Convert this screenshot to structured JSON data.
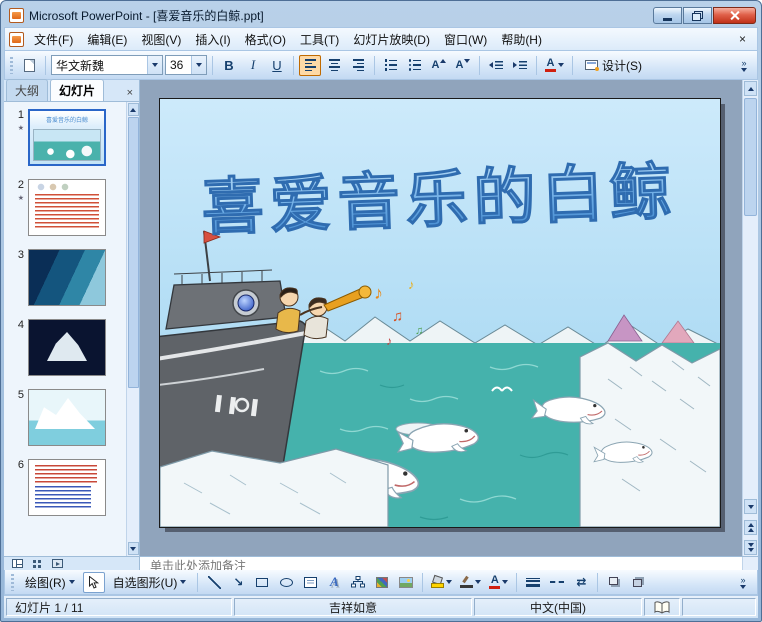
{
  "window": {
    "title": "Microsoft PowerPoint - [喜爱音乐的白鲸.ppt]"
  },
  "icons": {
    "close_x": "×",
    "star": "★",
    "letter_A": "A",
    "arrow_tool": "↘",
    "arrow_style": "⇄",
    "chevrons": "»"
  },
  "menu": {
    "items": [
      "文件(F)",
      "编辑(E)",
      "视图(V)",
      "插入(I)",
      "格式(O)",
      "工具(T)",
      "幻灯片放映(D)",
      "窗口(W)",
      "帮助(H)"
    ]
  },
  "format_toolbar": {
    "font_name": "华文新魏",
    "font_size": "36",
    "bold": "B",
    "italic": "I",
    "underline": "U",
    "design_label": "设计(S)"
  },
  "slides_panel": {
    "tab_outline": "大纲",
    "tab_slides": "幻灯片",
    "slides": [
      {
        "number": "1",
        "mini_title": "喜爱音乐的白鲸"
      },
      {
        "number": "2"
      },
      {
        "number": "3"
      },
      {
        "number": "4"
      },
      {
        "number": "5"
      },
      {
        "number": "6"
      }
    ]
  },
  "slide": {
    "title": "喜爱音乐的白鲸"
  },
  "notes": {
    "placeholder": "单击此处添加备注"
  },
  "draw_toolbar": {
    "draw_label": "绘图(R)",
    "autoshapes_label": "自选图形(U)"
  },
  "status_bar": {
    "slide_indicator": "幻灯片 1 / 11",
    "design_template": "吉祥如意",
    "language": "中文(中国)"
  },
  "colors": {
    "sea_teal": "#45b2ac",
    "sky_blue": "#c6e6f8",
    "title_blue": "#5b9bd5",
    "active_toggle": "#fdd9a7",
    "close_red": "#c03018"
  }
}
